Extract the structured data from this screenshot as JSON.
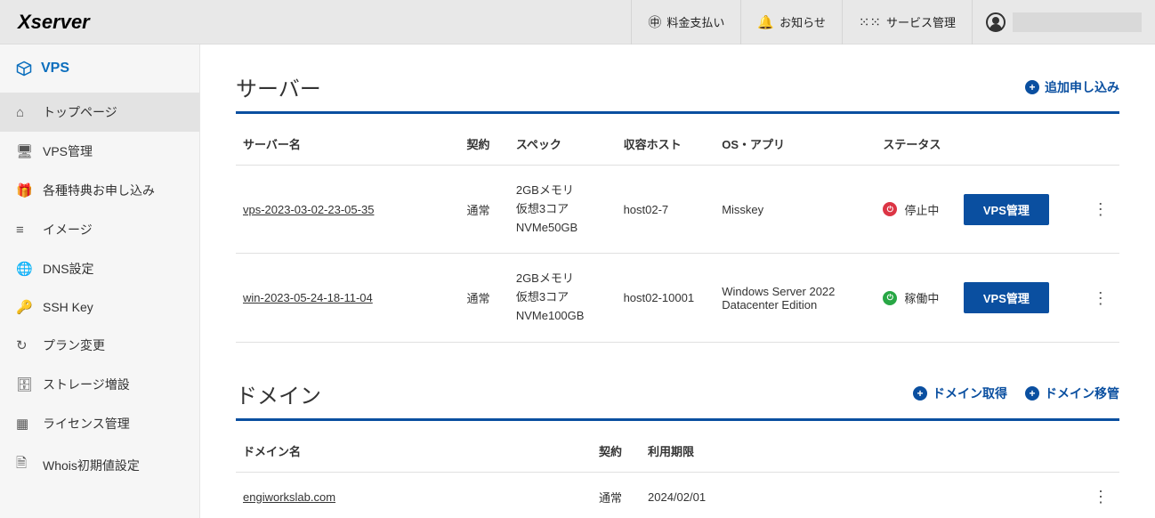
{
  "logo": "Xserver",
  "header": {
    "payment": "料金支払い",
    "notice": "お知らせ",
    "service": "サービス管理"
  },
  "sidebar": {
    "title": "VPS",
    "items": [
      {
        "label": "トップページ"
      },
      {
        "label": "VPS管理"
      },
      {
        "label": "各種特典お申し込み"
      },
      {
        "label": "イメージ"
      },
      {
        "label": "DNS設定"
      },
      {
        "label": "SSH Key"
      },
      {
        "label": "プラン変更"
      },
      {
        "label": "ストレージ増設"
      },
      {
        "label": "ライセンス管理"
      },
      {
        "label": "Whois初期値設定"
      }
    ]
  },
  "servers": {
    "title": "サーバー",
    "add_label": "追加申し込み",
    "headers": {
      "name": "サーバー名",
      "contract": "契約",
      "spec": "スペック",
      "host": "収容ホスト",
      "osapp": "OS・アプリ",
      "status": "ステータス"
    },
    "rows": [
      {
        "name": "vps-2023-03-02-23-05-35",
        "contract": "通常",
        "spec": "2GBメモリ\n仮想3コア\nNVMe50GB",
        "host": "host02-7",
        "osapp": "Misskey",
        "status": "停止中",
        "status_type": "stopped",
        "btn": "VPS管理"
      },
      {
        "name": "win-2023-05-24-18-11-04",
        "contract": "通常",
        "spec": "2GBメモリ\n仮想3コア\nNVMe100GB",
        "host": "host02-10001",
        "osapp": "Windows Server 2022 Datacenter Edition",
        "status": "稼働中",
        "status_type": "running",
        "btn": "VPS管理"
      }
    ]
  },
  "domains": {
    "title": "ドメイン",
    "get_label": "ドメイン取得",
    "transfer_label": "ドメイン移管",
    "headers": {
      "name": "ドメイン名",
      "contract": "契約",
      "expiry": "利用期限"
    },
    "rows": [
      {
        "name": "engiworkslab.com",
        "contract": "通常",
        "expiry": "2024/02/01"
      }
    ]
  }
}
